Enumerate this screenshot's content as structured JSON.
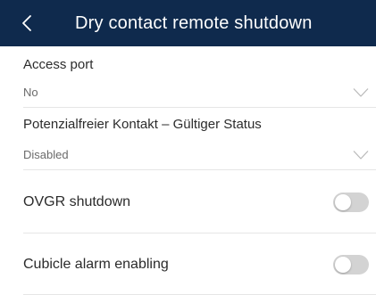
{
  "header": {
    "title": "Dry contact remote shutdown",
    "back_icon": "chevron-left-icon"
  },
  "settings": {
    "access_port": {
      "label": "Access port",
      "value": "No"
    },
    "dry_contact_status": {
      "label": "Potenzialfreier Kontakt – Gültiger Status",
      "value": "Disabled"
    },
    "ovgr_shutdown": {
      "label": "OVGR shutdown",
      "enabled": false
    },
    "cubicle_alarm": {
      "label": "Cubicle alarm enabling",
      "enabled": false
    }
  },
  "colors": {
    "header_bg": "#0f2a4d",
    "toggle_off": "#d3d3d3",
    "divider": "#e6e6e6"
  }
}
